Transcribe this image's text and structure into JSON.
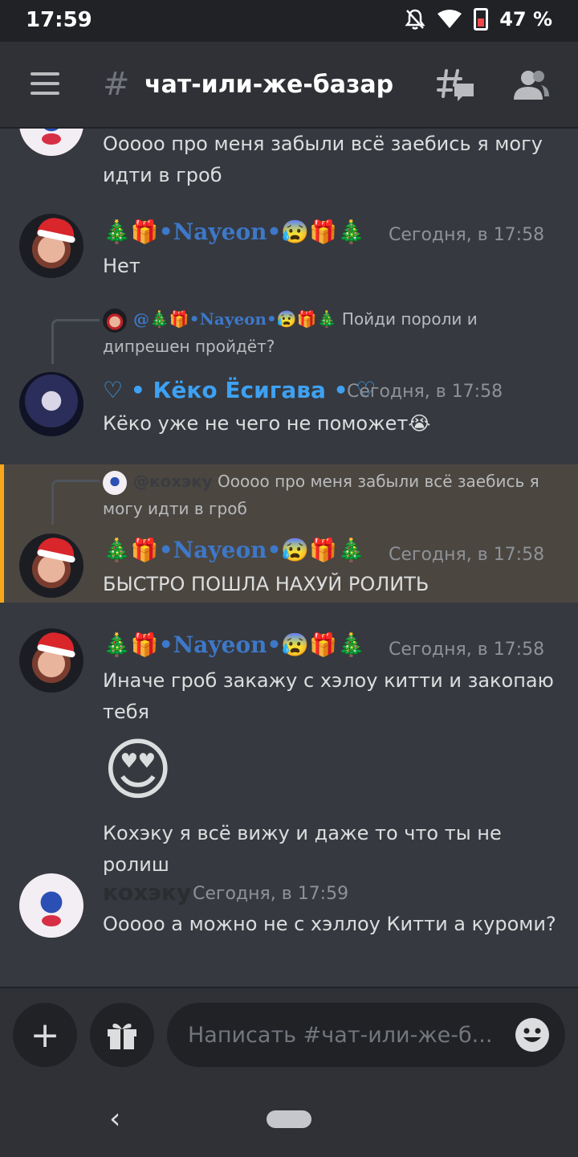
{
  "status_bar": {
    "time": "17:59",
    "battery": "47 %",
    "battery_level": 0.47
  },
  "header": {
    "hash": "#",
    "channel_name": "чат-или-же-базар"
  },
  "messages": [
    {
      "id": "m0",
      "text": "Ооооо про меня забыли всё заебись я могу идти в гроб"
    },
    {
      "id": "m1",
      "author": "🎄🎁•Nayeon•😰🎁🎄",
      "timestamp": "Сегодня, в 17:58",
      "text": "Нет"
    },
    {
      "id": "m2",
      "reply_author": "@🎄🎁•Nayeon•😰🎁🎄",
      "reply_text": "Пойди пороли и дипрешен пройдёт?",
      "author": "♡ • Кёко Ёсигава • ♡",
      "timestamp": "Сегодня, в 17:58",
      "text": "Кёко уже не чего не поможет😭"
    },
    {
      "id": "m3",
      "reply_author": "@кохэку",
      "reply_text": "Ооооо про меня забыли всё заебись я могу идти в гроб",
      "author": "🎄🎁•Nayeon•😰🎁🎄",
      "timestamp": "Сегодня, в 17:58",
      "text": "БЫСТРО ПОШЛА НАХУЙ РОЛИТЬ"
    },
    {
      "id": "m4",
      "author": "🎄🎁•Nayeon•😰🎁🎄",
      "timestamp": "Сегодня, в 17:58",
      "text": "Иначе гроб закажу с хэлоу китти и закопаю тебя",
      "emoji": "😍",
      "text2": "Кохэку я всё вижу и даже то что ты не ролиш"
    },
    {
      "id": "m5",
      "author": "кохэку",
      "timestamp": "Сегодня, в 17:59",
      "text": "Ооооо а можно не с хэллоу Китти а куроми?"
    }
  ],
  "composer": {
    "placeholder": "Написать #чат-или-же-б...",
    "plus": "+"
  },
  "nav": {
    "back": "‹"
  },
  "colors": {
    "highlight": "#4b4640",
    "mention_bar": "#faa61a",
    "nayeon_name": "#3d78c9",
    "keko_name": "#3ea1f2"
  },
  "icons": [
    "menu-icon",
    "hash-icon",
    "threads-icon",
    "members-icon",
    "gift-icon",
    "emoji-icon",
    "dnd-bell-icon",
    "wifi-icon",
    "battery-icon"
  ]
}
